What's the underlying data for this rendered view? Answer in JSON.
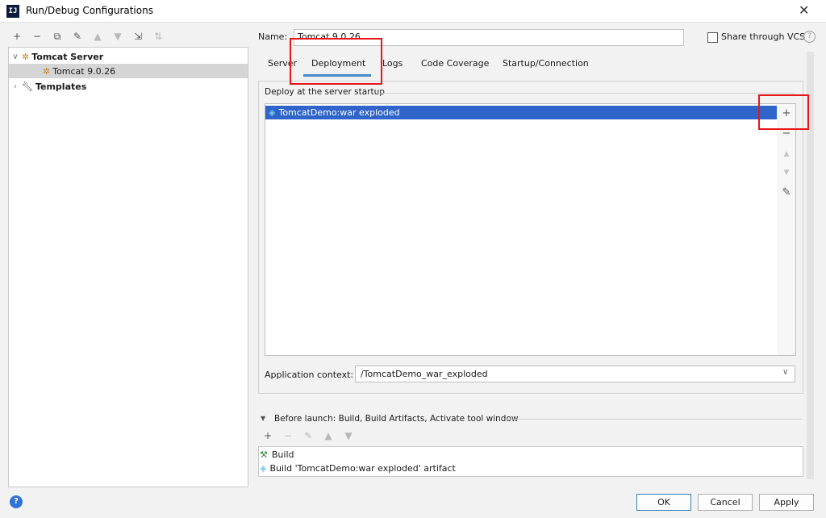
{
  "window": {
    "title": "Run/Debug Configurations",
    "app_icon_text": "IJ",
    "close_glyph": "✕"
  },
  "toolbar": [
    "+",
    "−",
    "⧉",
    "✎",
    "▲",
    "▼",
    "⇲",
    "⇅"
  ],
  "tree": {
    "group_label": "Tomcat Server",
    "config_label": "Tomcat 9.0.26",
    "templates_label": "Templates"
  },
  "name_field": {
    "label": "Name:",
    "value": "Tomcat 9.0.26"
  },
  "share_vcs": {
    "label": "Share through VCS",
    "checked": false
  },
  "tabs": [
    "Server",
    "Deployment",
    "Logs",
    "Code Coverage",
    "Startup/Connection"
  ],
  "active_tab": "Deployment",
  "deploy": {
    "group_title": "Deploy at the server startup",
    "items": [
      "TomcatDemo:war exploded"
    ]
  },
  "side_tools": {
    "add": "+",
    "remove": "−",
    "up": "▲",
    "down": "▼",
    "edit": "✎"
  },
  "app_context": {
    "label": "Application context:",
    "value": "/TomcatDemo_war_exploded"
  },
  "before_launch": {
    "title": "Before launch: Build, Build Artifacts, Activate tool window",
    "toolbar": [
      "+",
      "−",
      "✎",
      "▲",
      "▼"
    ],
    "items": [
      "Build",
      "Build 'TomcatDemo:war exploded' artifact"
    ]
  },
  "buttons": {
    "ok": "OK",
    "cancel": "Cancel",
    "apply": "Apply",
    "help": "?"
  },
  "colors": {
    "selection": "#2f65ca",
    "tab_underline": "#4a88c7",
    "highlight": "#e8161b"
  }
}
